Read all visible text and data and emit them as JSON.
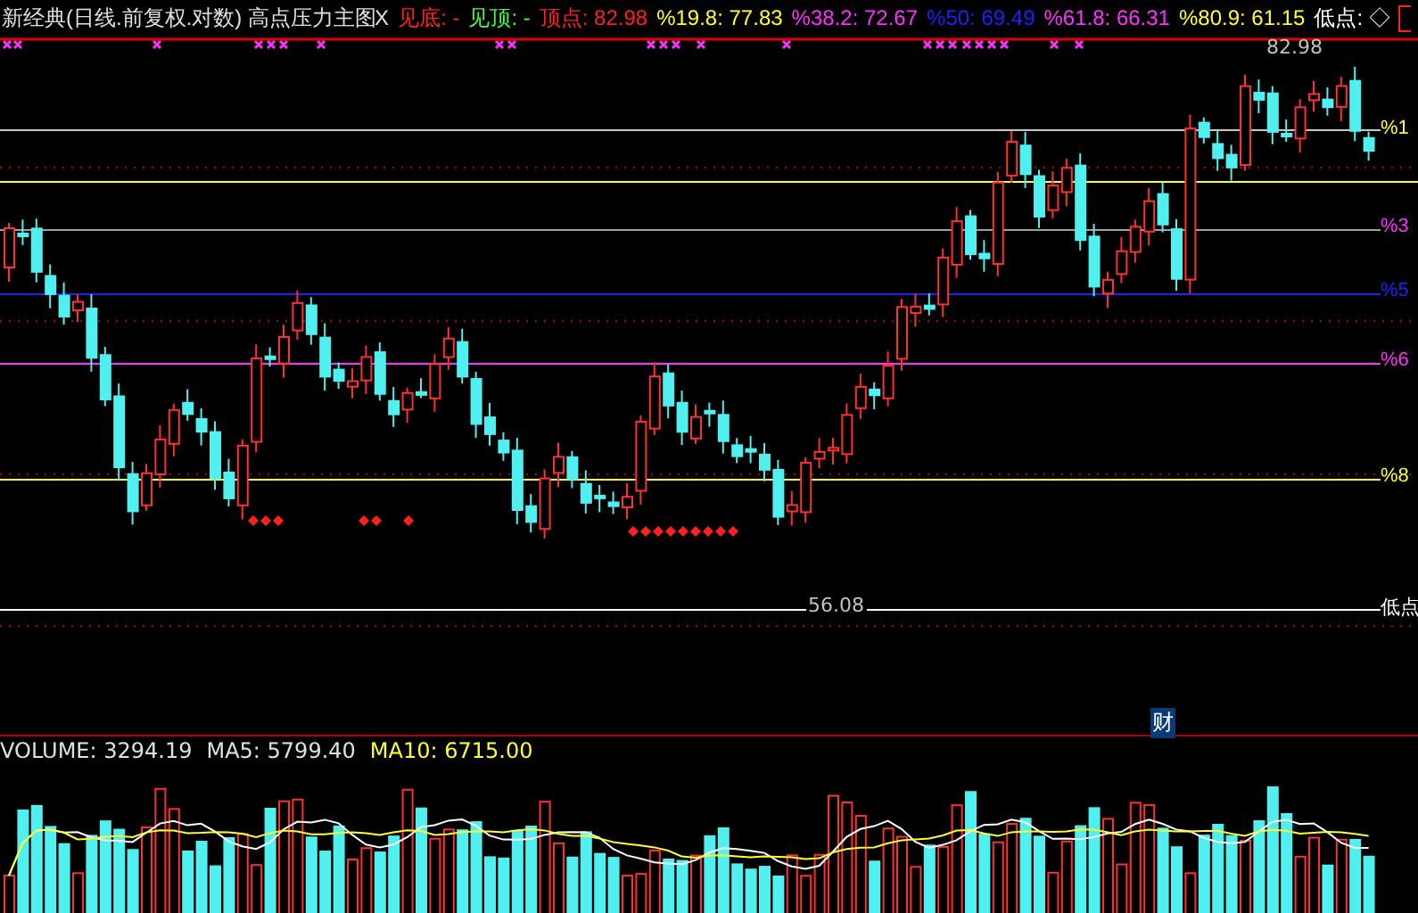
{
  "indicator": {
    "title": "新经典(日线.前复权.对数) 高点压力主图",
    "close": "X"
  },
  "legend": [
    {
      "label": "见底:",
      "value": "-",
      "color": "#ff2020"
    },
    {
      "label": "见顶:",
      "value": "-",
      "color": "#40ff40"
    },
    {
      "label": "顶点:",
      "value": "82.98",
      "color": "#ff2020"
    },
    {
      "label": "%19.8:",
      "value": "77.83",
      "color": "#ffff30"
    },
    {
      "label": "%38.2:",
      "value": "72.67",
      "color": "#ff30ff"
    },
    {
      "label": "%50:",
      "value": "69.49",
      "color": "#2020ff"
    },
    {
      "label": "%61.8:",
      "value": "66.31",
      "color": "#ff30ff"
    },
    {
      "label": "%80.9:",
      "value": "61.15",
      "color": "#ffff30"
    },
    {
      "label": "低点:",
      "value": "◇",
      "color": "#ffffff"
    }
  ],
  "levels": [
    {
      "label": "%1",
      "color": "#ffff30"
    },
    {
      "label": "%3",
      "color": "#ff30ff"
    },
    {
      "label": "%5",
      "color": "#2020ff"
    },
    {
      "label": "%6",
      "color": "#ff30ff"
    },
    {
      "label": "%8",
      "color": "#ffff30"
    },
    {
      "label": "低点",
      "color": "#ffffff"
    }
  ],
  "price_labels": {
    "high": "82.98",
    "low": "56.08"
  },
  "volume_legend": [
    {
      "label": "VOLUME:",
      "value": "3294.19",
      "color": "#e0e0e0"
    },
    {
      "label": "MA5:",
      "value": "5799.40",
      "color": "#e0e0e0"
    },
    {
      "label": "MA10:",
      "value": "6715.00",
      "color": "#ffff30"
    }
  ],
  "badge": "财"
}
